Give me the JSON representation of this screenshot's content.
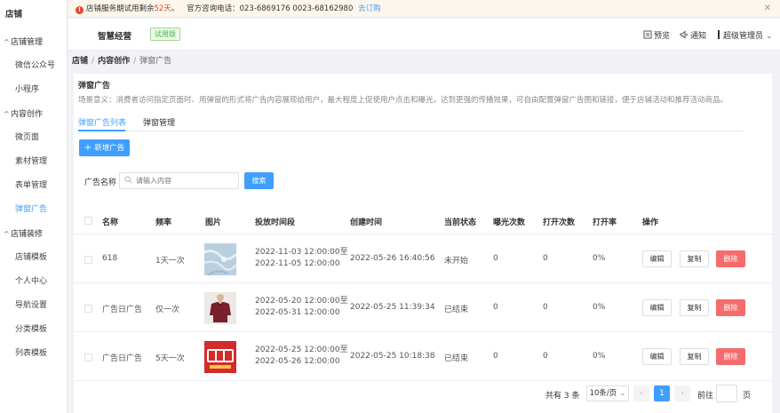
{
  "sidebar": {
    "title": "店铺",
    "groups": [
      {
        "label": "店铺管理",
        "items": [
          "微信公众号",
          "小程序"
        ]
      },
      {
        "label": "内容创作",
        "items": [
          "微页面",
          "素材管理",
          "表单管理",
          "弹窗广告"
        ]
      },
      {
        "label": "店铺装修",
        "items": [
          "店铺模板",
          "个人中心",
          "导航设置",
          "分类模板",
          "列表模板"
        ]
      }
    ],
    "active_item": "弹窗广告"
  },
  "notice": {
    "text_prefix": "店铺服务期试用剩余",
    "days": "52天",
    "text_mid": "。",
    "phone_text": "官方咨询电话：023-6869176 0023-68162980",
    "link": "去订购",
    "close": "✕"
  },
  "header": {
    "brand": "智慧经营",
    "badge": "试用版",
    "preview": "预览",
    "notify": "通知",
    "user": "超级管理员"
  },
  "breadcrumb": {
    "root": "店铺",
    "parent": "内容创作",
    "current": "弹窗广告"
  },
  "page": {
    "title": "弹窗广告",
    "description": "场景意义：消费者访问指定页面时、用弹窗的形式将广告内容展现给用户，最大程度上促使用户点击和曝光，达到更强的传播效果，可自由配置弹窗广告图和链接，便于店铺活动和推荐活动商品。"
  },
  "tabs": [
    "弹窗广告列表",
    "弹窗管理"
  ],
  "toolbar": {
    "add_label": "新增广告",
    "search_label": "广告名称",
    "search_placeholder": "请输入内容",
    "search_button": "搜索"
  },
  "table": {
    "headers": [
      "名称",
      "频率",
      "图片",
      "投放时间段",
      "创建时间",
      "当前状态",
      "曝光次数",
      "打开次数",
      "打开率",
      "操作"
    ],
    "rows": [
      {
        "name": "618",
        "freq": "1天一次",
        "image": "fabric-photo",
        "period_start": "2022-11-03 12:00:00至",
        "period_end": "2022-11-05 12:00:00",
        "created": "2022-05-26 16:40:56",
        "status": "未开始",
        "exposure": "0",
        "opens": "0",
        "rate": "0%"
      },
      {
        "name": "广告日广告",
        "freq": "仅一次",
        "image": "shirt-photo",
        "period_start": "2022-05-20 12:00:00至",
        "period_end": "2022-05-31 12:00:00",
        "created": "2022-05-25 11:39:34",
        "status": "已结束",
        "exposure": "0",
        "opens": "0",
        "rate": "0%"
      },
      {
        "name": "广告日广告",
        "freq": "5天一次",
        "image": "promo-poster",
        "period_start": "2022-05-25 12:00:00至",
        "period_end": "2022-05-26 12:00:00",
        "created": "2022-05-25 10:18:38",
        "status": "已结束",
        "exposure": "0",
        "opens": "0",
        "rate": "0%"
      }
    ],
    "actions": {
      "edit": "编辑",
      "copy": "复制",
      "delete": "删除"
    }
  },
  "pagination": {
    "total": "共有 3 条",
    "page_size": "10条/页",
    "current": "1",
    "goto": "前往",
    "page_unit": "页"
  },
  "colors": {
    "primary": "#409eff",
    "danger": "#f56c6c",
    "warning_bg": "#fdf6ec",
    "trial_green": "#4caf50"
  }
}
